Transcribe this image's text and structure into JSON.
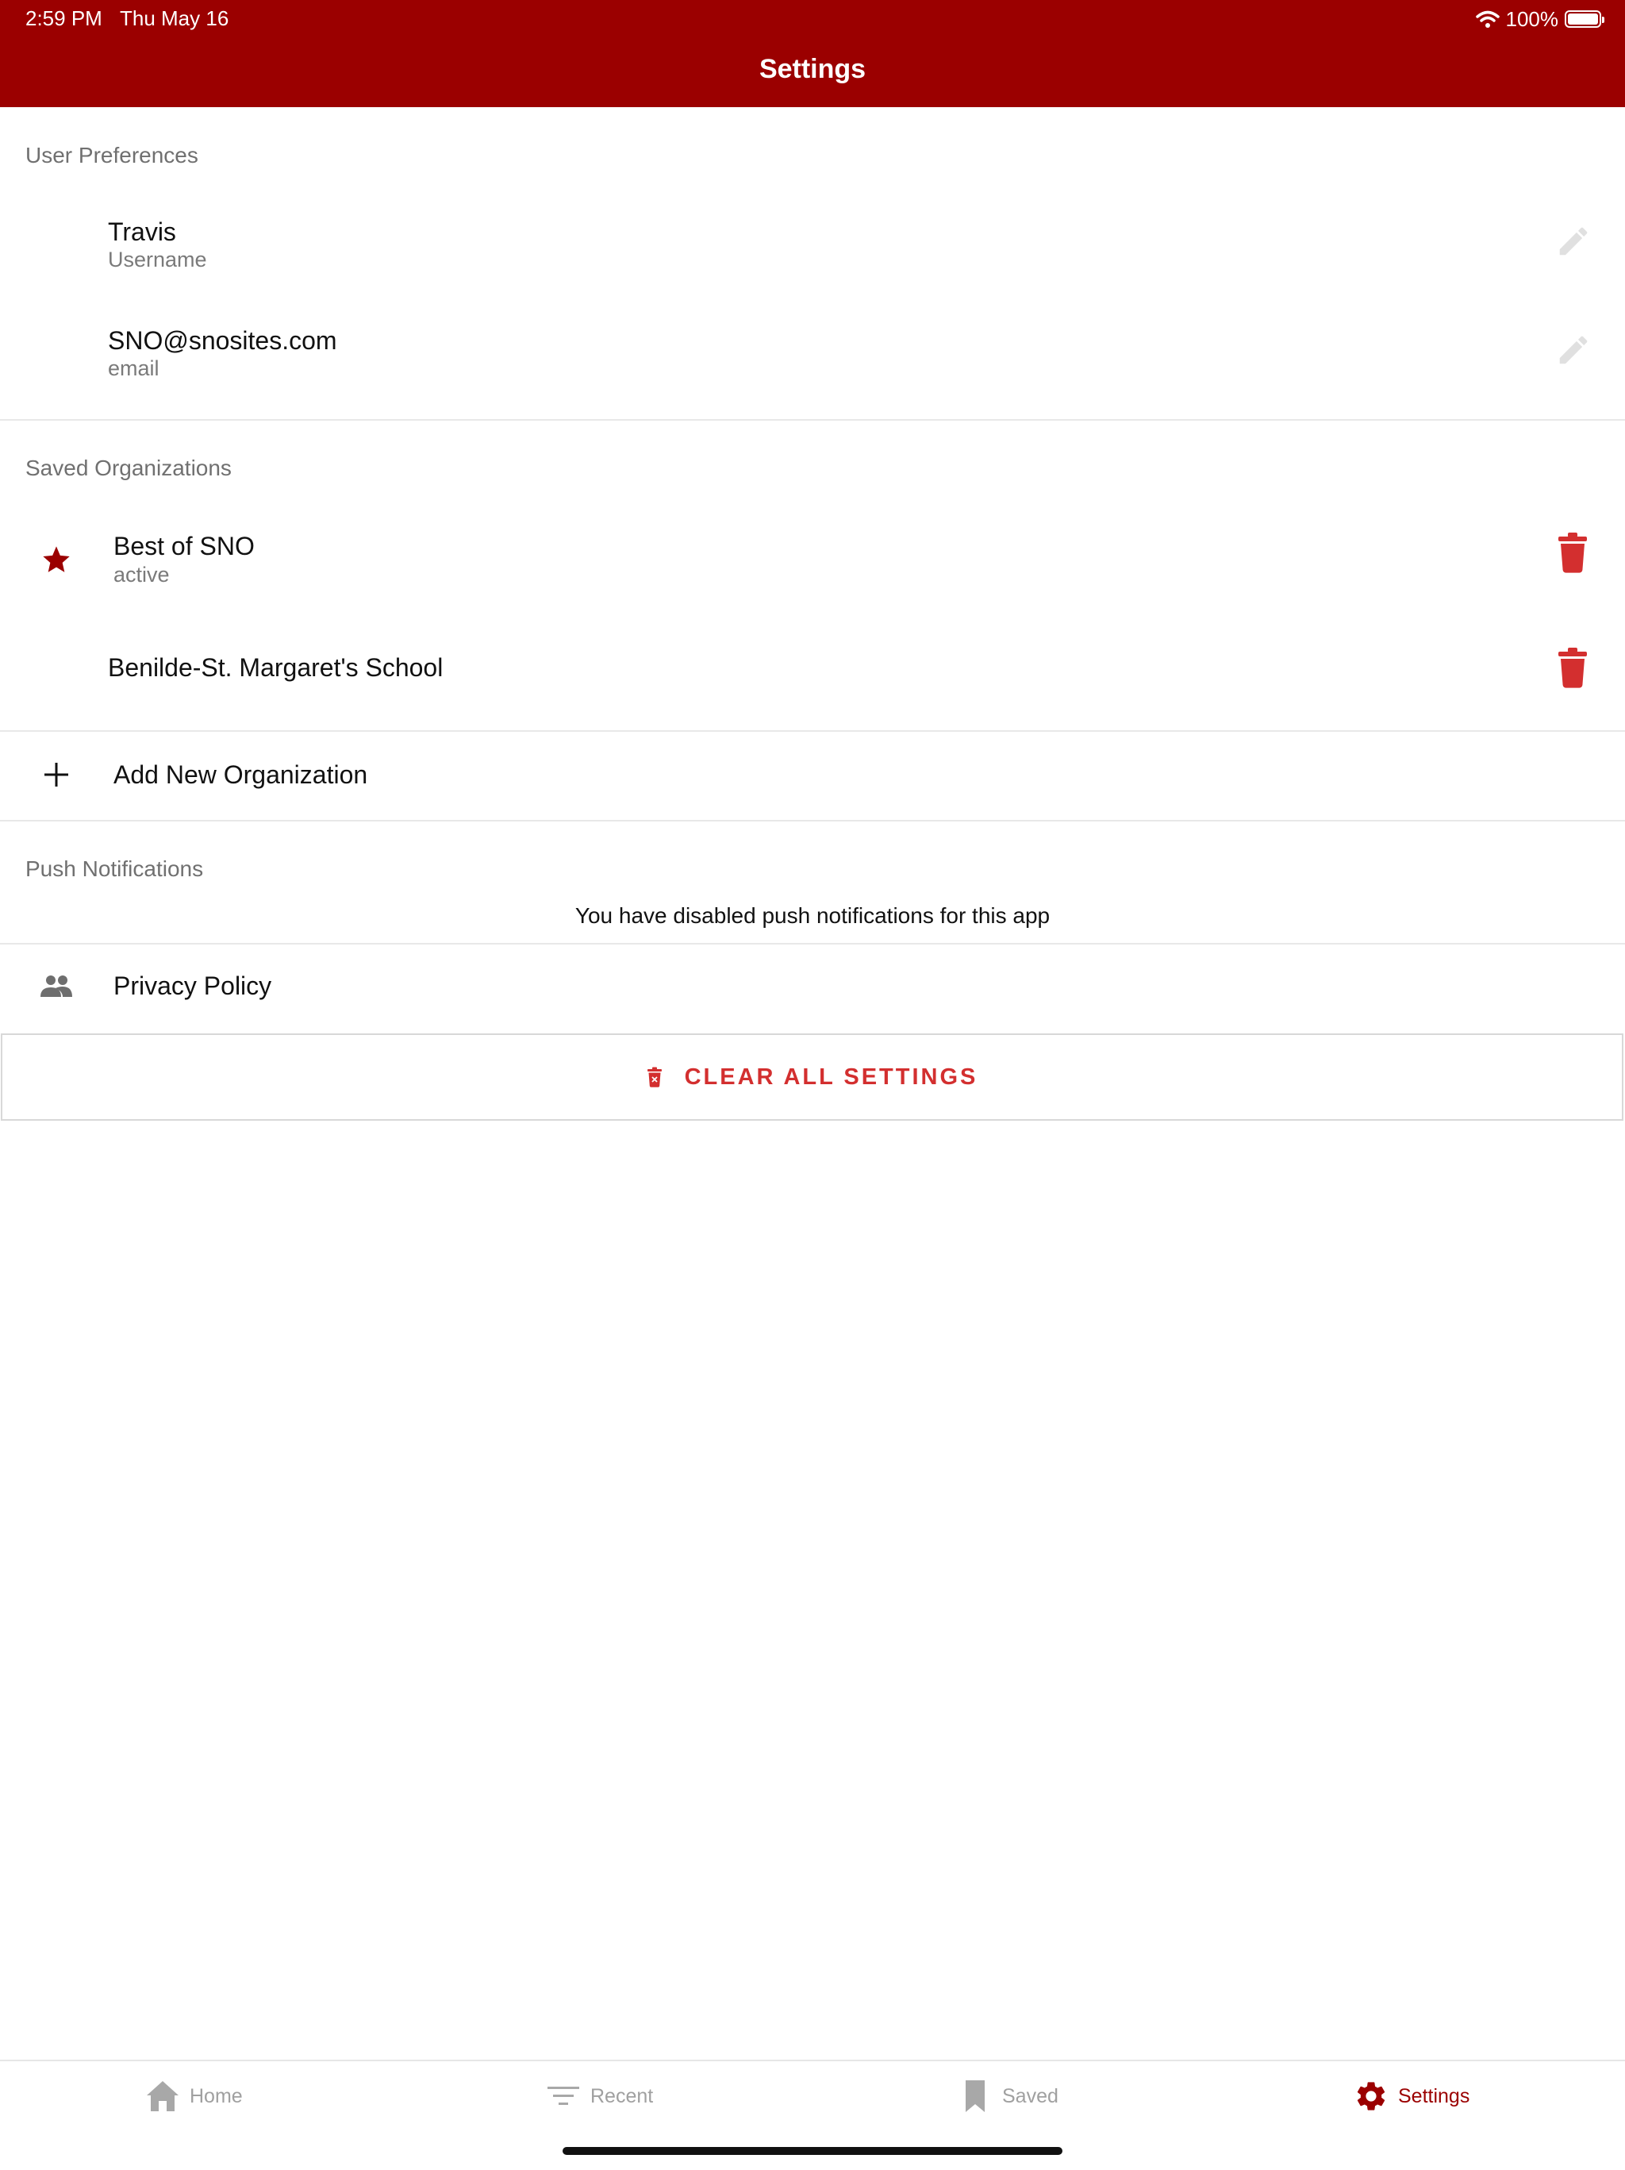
{
  "status": {
    "time": "2:59 PM",
    "date": "Thu May 16",
    "battery": "100%"
  },
  "nav": {
    "title": "Settings"
  },
  "user_preferences": {
    "label": "User Preferences",
    "username": {
      "value": "Travis",
      "sub": "Username"
    },
    "email": {
      "value": "SNO@snosites.com",
      "sub": "email"
    }
  },
  "saved_organizations": {
    "label": "Saved Organizations",
    "items": [
      {
        "name": "Best of SNO",
        "sub": "active"
      },
      {
        "name": "Benilde-St. Margaret's School"
      }
    ],
    "add_label": "Add New Organization"
  },
  "push": {
    "label": "Push Notifications",
    "message": "You have disabled push notifications for this app"
  },
  "privacy": {
    "label": "Privacy Policy"
  },
  "clear": {
    "label": "CLEAR ALL SETTINGS"
  },
  "tabs": [
    {
      "label": "Home",
      "icon": "home-icon"
    },
    {
      "label": "Recent",
      "icon": "filter-list-icon"
    },
    {
      "label": "Saved",
      "icon": "bookmark-icon"
    },
    {
      "label": "Settings",
      "icon": "gear-icon"
    }
  ],
  "colors": {
    "brand": "#9b0000",
    "danger": "#d32f2f",
    "muted": "#a0a0a0"
  }
}
